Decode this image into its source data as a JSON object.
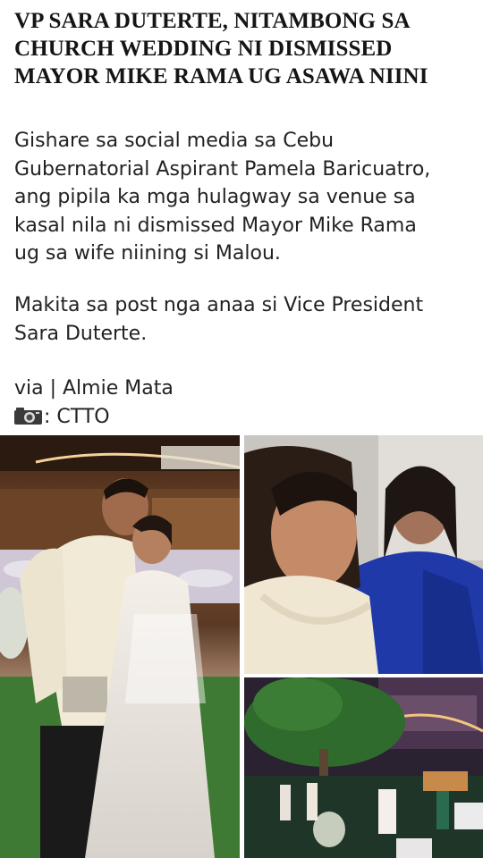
{
  "post": {
    "headline_lines": [
      "VP SARA DUTERTE, NITAMBONG SA",
      "CHURCH WEDDING NI DISMISSED",
      "MAYOR MIKE RAMA UG ASAWA NIINI"
    ],
    "paragraph1_lines": [
      "Gishare sa social media sa Cebu",
      "Gubernatorial Aspirant Pamela Baricuatro,",
      "ang pipila ka mga hulagway sa venue sa",
      "kasal nila ni dismissed Mayor Mike Rama",
      "ug sa wife niining si Malou."
    ],
    "paragraph2_lines": [
      "Makita sa post nga anaa si Vice President",
      "Sara Duterte."
    ],
    "via_line": "via | Almie Mata",
    "photo_credit": ": CTTO",
    "photo_credit_icon": "camera-icon"
  },
  "photos": {
    "main": "couple-wedding-photo",
    "top_right": "two-women-portrait-photo",
    "bottom_right": "wedding-venue-photo"
  },
  "colors": {
    "headline": "#151515",
    "body_text": "#222222",
    "background": "#ffffff"
  }
}
